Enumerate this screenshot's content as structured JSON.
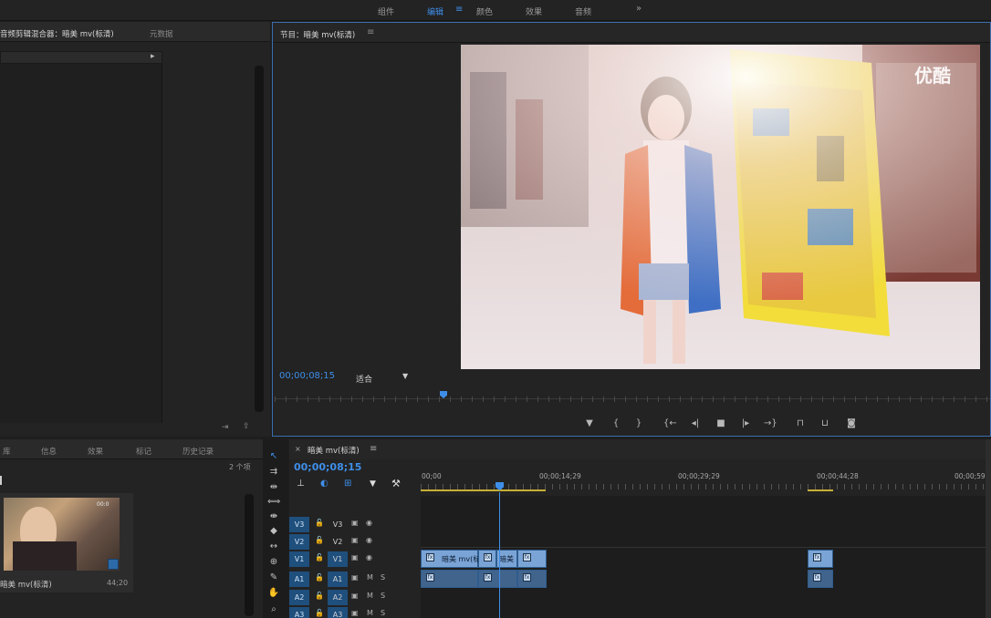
{
  "workspaces": {
    "items": [
      {
        "label": "组件"
      },
      {
        "label": "编辑"
      },
      {
        "label": "颜色"
      },
      {
        "label": "效果"
      },
      {
        "label": "音频"
      }
    ],
    "active_index": 1,
    "overflow_icon": "chevron-double-right-icon"
  },
  "source_panel": {
    "tab_mixer": "音频剪辑混合器：暗美 mv(标清)",
    "tab_metadata": "元数据"
  },
  "project_panel": {
    "tabs": [
      "库",
      "信息",
      "效果",
      "标记",
      "历史记录"
    ],
    "item_count": "2 个项",
    "clip_name": "暗美 mv(标清)",
    "clip_duration": "44;20",
    "thumb_badge": "00:0"
  },
  "program": {
    "title": "节目：暗美 mv(标清)",
    "timecode": "00;00;08;15",
    "fit": "适合",
    "watermark": "优酷"
  },
  "timeline": {
    "tab_title": "暗美 mv(标清)",
    "timecode": "00;00;08;15",
    "ruler": [
      "00;00",
      "00;00;14;29",
      "00;00;29;29",
      "00;00;44;28",
      "00;00;59;2"
    ],
    "video_tracks": [
      {
        "target": "V3",
        "name": "V3"
      },
      {
        "target": "V2",
        "name": "V2"
      },
      {
        "target": "V1",
        "name": "V1"
      }
    ],
    "audio_tracks": [
      {
        "target": "A1",
        "name": "A1",
        "m": "M",
        "s": "S"
      },
      {
        "target": "A2",
        "name": "A2",
        "m": "M",
        "s": "S"
      },
      {
        "target": "A3",
        "name": "A3",
        "m": "M",
        "s": "S"
      }
    ],
    "v1_clips": [
      {
        "label": "暗美 mv(标"
      },
      {
        "label": ""
      },
      {
        "label": "暗美"
      },
      {
        "label": ""
      },
      {
        "label": ""
      }
    ]
  },
  "colors": {
    "accent": "#3e8ee8",
    "video_clip": "#7aa4d6",
    "audio_clip": "#41648d",
    "target_on": "#1f4f7d"
  }
}
